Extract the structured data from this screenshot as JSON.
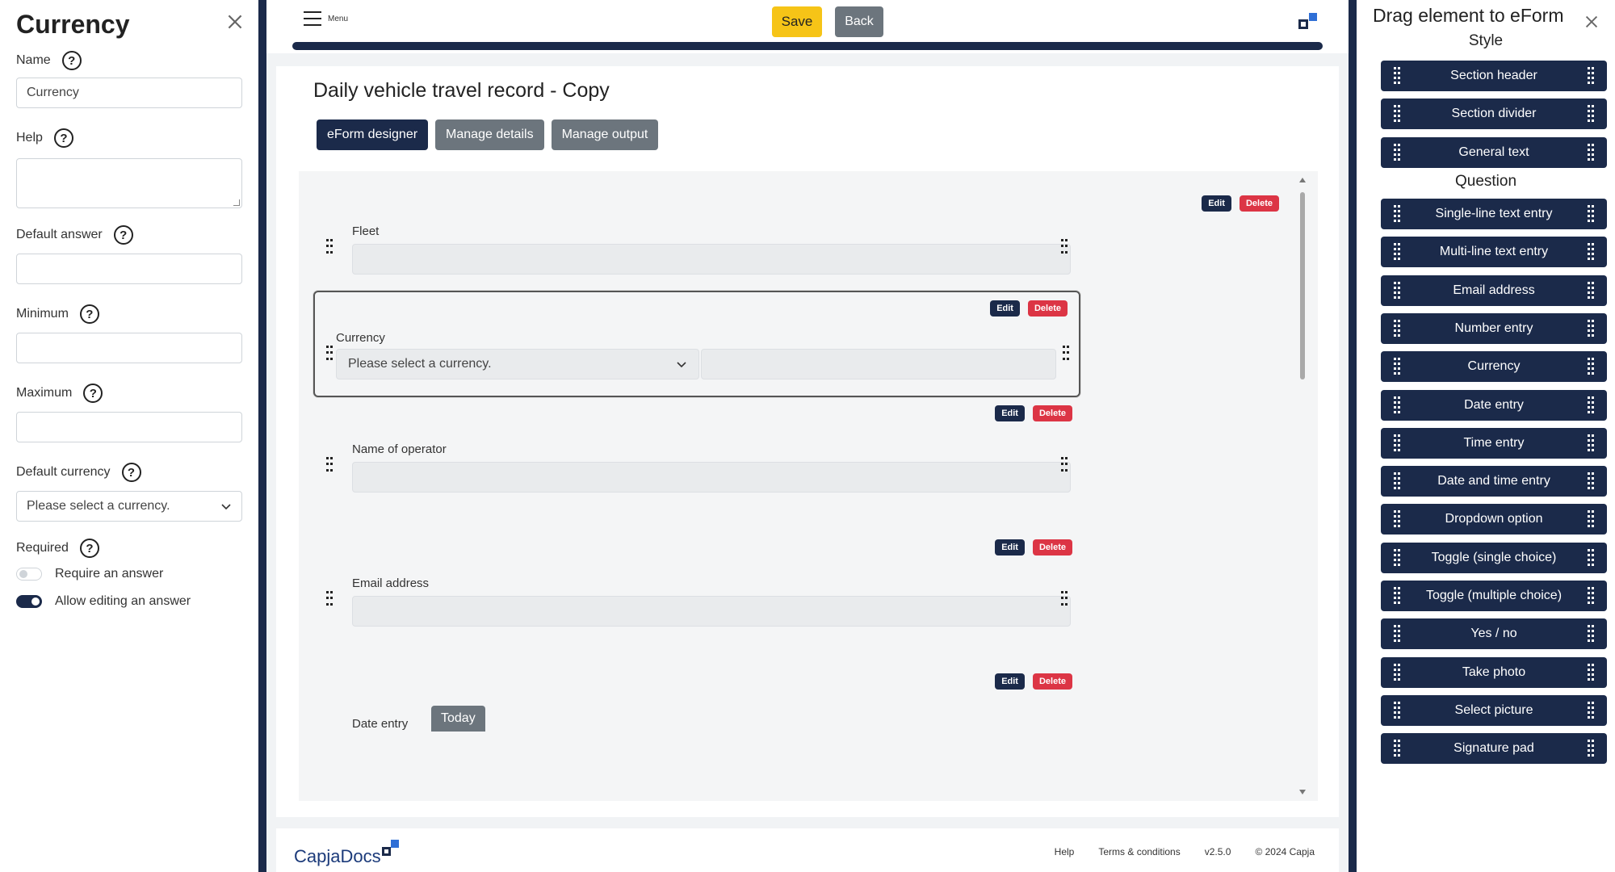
{
  "left_panel": {
    "title": "Currency",
    "name_label": "Name",
    "name_value": "Currency",
    "help_label": "Help",
    "default_answer_label": "Default answer",
    "minimum_label": "Minimum",
    "maximum_label": "Maximum",
    "default_currency_label": "Default currency",
    "default_currency_value": "Please select a currency.",
    "required_label": "Required",
    "require_answer_label": "Require an answer",
    "require_answer_on": false,
    "allow_editing_label": "Allow editing an answer",
    "allow_editing_on": true
  },
  "topbar": {
    "menu_label": "Menu",
    "save_label": "Save",
    "back_label": "Back"
  },
  "main": {
    "title": "Daily vehicle travel record - Copy",
    "tabs": [
      "eForm designer",
      "Manage details",
      "Manage output"
    ],
    "active_tab": "eForm designer",
    "edit_label": "Edit",
    "delete_label": "Delete",
    "elements": [
      {
        "label": "Fleet",
        "type": "text"
      },
      {
        "label": "Currency",
        "type": "currency",
        "select_value": "Please select a currency."
      },
      {
        "label": "Name of operator",
        "type": "text"
      },
      {
        "label": "Email address",
        "type": "text"
      },
      {
        "label": "Date entry",
        "type": "date",
        "today_label": "Today"
      }
    ]
  },
  "footer": {
    "logo_text": "CapjaDocs",
    "links": [
      "Help",
      "Terms & conditions",
      "v2.5.0",
      "© 2024 Capja"
    ]
  },
  "right_panel": {
    "title": "Drag element to eForm",
    "style_heading": "Style",
    "style_items": [
      "Section header",
      "Section divider",
      "General text"
    ],
    "question_heading": "Question",
    "question_items": [
      "Single-line text entry",
      "Multi-line text entry",
      "Email address",
      "Number entry",
      "Currency",
      "Date entry",
      "Time entry",
      "Date and time entry",
      "Dropdown option",
      "Toggle (single choice)",
      "Toggle (multiple choice)",
      "Yes / no",
      "Take photo",
      "Select picture",
      "Signature pad"
    ]
  },
  "colors": {
    "navy": "#1b2a4a",
    "save_yellow": "#f6c417",
    "delete_red": "#dc3545",
    "secondary_gray": "#6c757d"
  }
}
